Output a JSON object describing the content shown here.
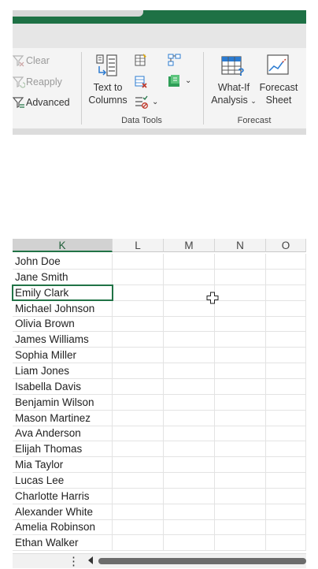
{
  "ribbon": {
    "sort_filter": {
      "clear": "Clear",
      "reapply": "Reapply",
      "advanced": "Advanced"
    },
    "data_tools": {
      "text_to_columns_line1": "Text to",
      "text_to_columns_line2": "Columns",
      "group_label": "Data Tools"
    },
    "forecast": {
      "what_if_line1": "What-If",
      "what_if_line2": "Analysis",
      "forecast_sheet_line1": "Forecast",
      "forecast_sheet_line2": "Sheet",
      "group_label": "Forecast"
    }
  },
  "grid": {
    "columns": [
      "K",
      "L",
      "M",
      "N",
      "O"
    ],
    "selected_column": "K",
    "active_row_index": 2,
    "names": [
      "John Doe",
      "Jane Smith",
      "Emily Clark",
      "Michael Johnson",
      "Olivia Brown",
      "James Williams",
      "Sophia Miller",
      "Liam Jones",
      "Isabella Davis",
      "Benjamin Wilson",
      "Mason Martinez",
      "Ava Anderson",
      "Elijah Thomas",
      "Mia Taylor",
      "Lucas Lee",
      "Charlotte Harris",
      "Alexander White",
      "Amelia Robinson",
      "Ethan Walker"
    ]
  },
  "colors": {
    "excel_green": "#217346",
    "titlebar": "#1e7145"
  }
}
